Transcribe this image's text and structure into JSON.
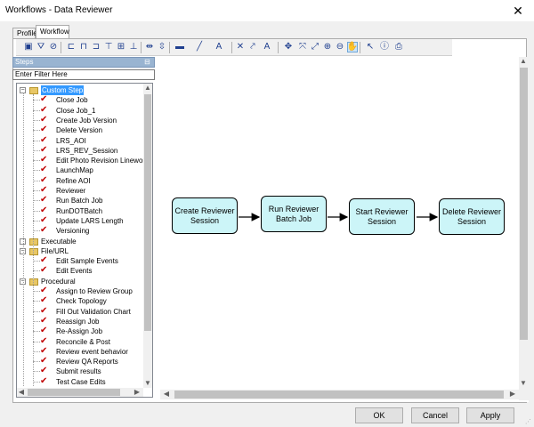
{
  "window": {
    "title": "Workflows - Data Reviewer",
    "close_glyph": "✕"
  },
  "tabs": [
    {
      "label": "Profile"
    },
    {
      "label": "Workflow"
    }
  ],
  "toolbar": {
    "icons": [
      "save-icon",
      "route-icon",
      "clear-icon",
      "align-left-icon",
      "align-center-icon",
      "align-right-icon",
      "align-top-icon",
      "align-middle-icon",
      "align-bottom-icon",
      "distribute-horizontal-icon",
      "distribute-vertical-icon",
      "fill-color-icon",
      "line-color-icon",
      "font-color-icon",
      "delete-icon",
      "connect-icon",
      "font-icon",
      "pan-icon",
      "fit-icon",
      "full-extent-icon",
      "zoom-in-icon",
      "zoom-out-icon",
      "hand-icon",
      "pointer-icon",
      "info-icon",
      "print-icon"
    ]
  },
  "steps_panel": {
    "title": "Steps",
    "filter_placeholder": "Enter Filter Here",
    "tree": [
      {
        "label": "Custom Step",
        "type": "folder",
        "expanded": true,
        "selected": true
      },
      {
        "label": "Close Job",
        "type": "step"
      },
      {
        "label": "Close Job_1",
        "type": "step"
      },
      {
        "label": "Create Job Version",
        "type": "step"
      },
      {
        "label": "Delete Version",
        "type": "step"
      },
      {
        "label": "LRS_AOI",
        "type": "step"
      },
      {
        "label": "LRS_REV_Session",
        "type": "step"
      },
      {
        "label": "Edit Photo Revision Linework",
        "type": "step"
      },
      {
        "label": "LaunchMap",
        "type": "step"
      },
      {
        "label": "Refine AOI",
        "type": "step"
      },
      {
        "label": "Reviewer",
        "type": "step"
      },
      {
        "label": "Run Batch Job",
        "type": "step"
      },
      {
        "label": "RunDOTBatch",
        "type": "step"
      },
      {
        "label": "Update LARS Length",
        "type": "step"
      },
      {
        "label": "Versioning",
        "type": "step"
      },
      {
        "label": "Executable",
        "type": "folder",
        "expanded": false
      },
      {
        "label": "File/URL",
        "type": "folder",
        "expanded": true
      },
      {
        "label": "Edit Sample Events",
        "type": "step"
      },
      {
        "label": "Edit Events",
        "type": "step"
      },
      {
        "label": "Procedural",
        "type": "folder",
        "expanded": true
      },
      {
        "label": "Assign to Review Group",
        "type": "step"
      },
      {
        "label": "Check Topology",
        "type": "step"
      },
      {
        "label": "Fill Out Validation Chart",
        "type": "step"
      },
      {
        "label": "Reassign Job",
        "type": "step"
      },
      {
        "label": "Re-Assign Job",
        "type": "step"
      },
      {
        "label": "Reconcile & Post",
        "type": "step"
      },
      {
        "label": "Review event behavior",
        "type": "step"
      },
      {
        "label": "Review QA Reports",
        "type": "step"
      },
      {
        "label": "Submit results",
        "type": "step"
      },
      {
        "label": "Test Case Edits",
        "type": "step"
      }
    ]
  },
  "workflow": {
    "nodes": [
      {
        "label": "Create Reviewer Session"
      },
      {
        "label": "Run Reviewer Batch Job"
      },
      {
        "label": "Start Reviewer Session"
      },
      {
        "label": "Delete Reviewer Session"
      }
    ]
  },
  "buttons": {
    "ok": "OK",
    "cancel": "Cancel",
    "apply": "Apply"
  }
}
